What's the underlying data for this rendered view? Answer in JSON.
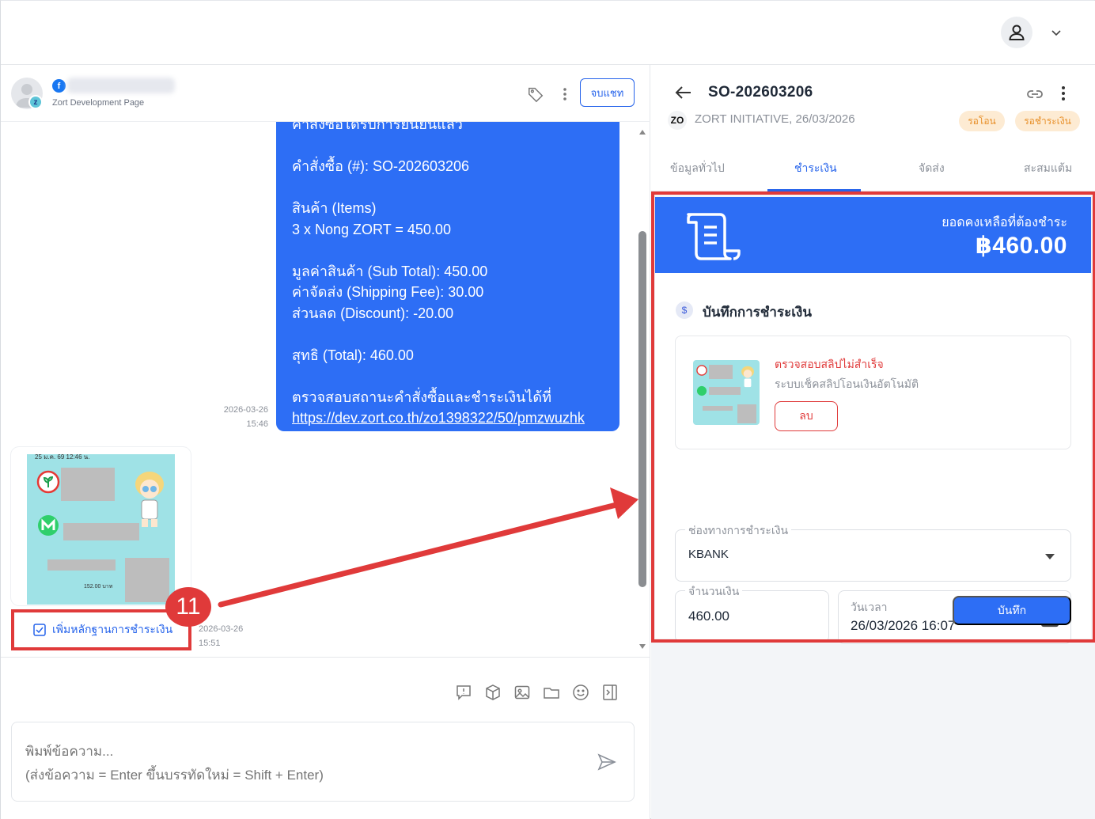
{
  "chat": {
    "page_name": "Zort Development Page",
    "end_chat_label": "จบแชท",
    "message_lines": [
      "คำสั่งซื้อได้รับการยืนยันแล้ว",
      "",
      "คำสั่งซื้อ (#): SO-202603206",
      "",
      "สินค้า (Items)",
      "3 x Nong ZORT = 450.00",
      "",
      "มูลค่าสินค้า (Sub Total): 450.00",
      "ค่าจัดส่ง (Shipping Fee): 30.00",
      "ส่วนลด (Discount): -20.00",
      "",
      "สุทธิ (Total): 460.00",
      "",
      "ตรวจสอบสถานะคำสั่งซื้อและชำระเงินได้ที่"
    ],
    "message_link": "https://dev.zort.co.th/zo1398322/50/pmzwuzhk",
    "msg1_date": "2026-03-26",
    "msg1_time": "15:46",
    "add_proof_label": "เพิ่มหลักฐานการชำระเงิน",
    "step_number": "11",
    "msg2_date": "2026-03-26",
    "msg2_time": "15:51",
    "slip_header": "25 ม.ค. 69 12:46 น.",
    "slip_amount": "152.00 บาท",
    "input_placeholder": "พิมพ์ข้อความ...\n(ส่งข้อความ = Enter ขึ้นบรรทัดใหม่ = Shift + Enter)"
  },
  "order": {
    "so_number": "SO-202603206",
    "company_logo": "ZO",
    "company": "ZORT INITIATIVE, 26/03/2026",
    "badges": [
      "รอโอน",
      "รอชำระเงิน"
    ],
    "badge_color": "#e8902a",
    "tabs": [
      "ข้อมูลทั่วไป",
      "ชำระเงิน",
      "จัดส่ง",
      "สะสมแต้ม"
    ],
    "active_tab": "ชำระเงิน",
    "balance_label": "ยอดคงเหลือที่ต้องชำระ",
    "balance_amount": "฿460.00",
    "section_title": "บันทึกการชำระเงิน",
    "slip_status": "ตรวจสอบสลิปไม่สำเร็จ",
    "slip_note": "ระบบเช็คสลิปโอนเงินอัตโนมัติ",
    "delete_label": "ลบ",
    "channel_label": "ช่องทางการชำระเงิน",
    "channel_value": "KBANK",
    "amount_label": "จำนวนเงิน",
    "amount_value": "460.00",
    "datetime_label": "วันเวลา",
    "datetime_value": "26/03/2026 16:07",
    "save_label": "บันทึก"
  },
  "colors": {
    "accent": "#2d6ef5",
    "highlight": "#e03a3a"
  }
}
